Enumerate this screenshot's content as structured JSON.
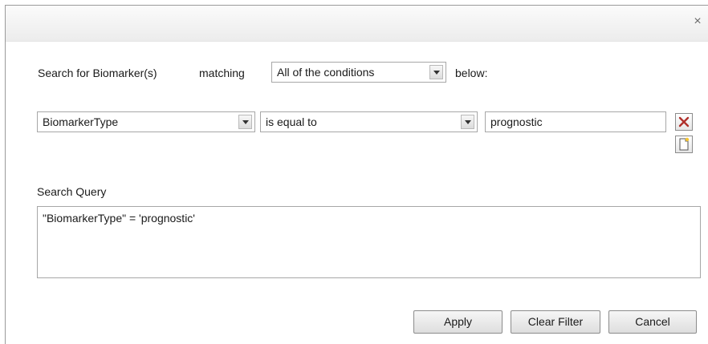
{
  "dialog": {
    "close_glyph": "×"
  },
  "search": {
    "prefix_label": "Search for Biomarker(s)",
    "matching_label": "matching",
    "match_mode": "All of the conditions",
    "suffix_label": "below:"
  },
  "condition": {
    "field": "BiomarkerType",
    "operator": "is equal to",
    "value": "prognostic"
  },
  "query": {
    "label": "Search Query",
    "text": "\"BiomarkerType\" = 'prognostic'"
  },
  "buttons": {
    "apply": "Apply",
    "clear_filter": "Clear Filter",
    "cancel": "Cancel"
  },
  "colors": {
    "remove_icon": "#b0302b"
  }
}
